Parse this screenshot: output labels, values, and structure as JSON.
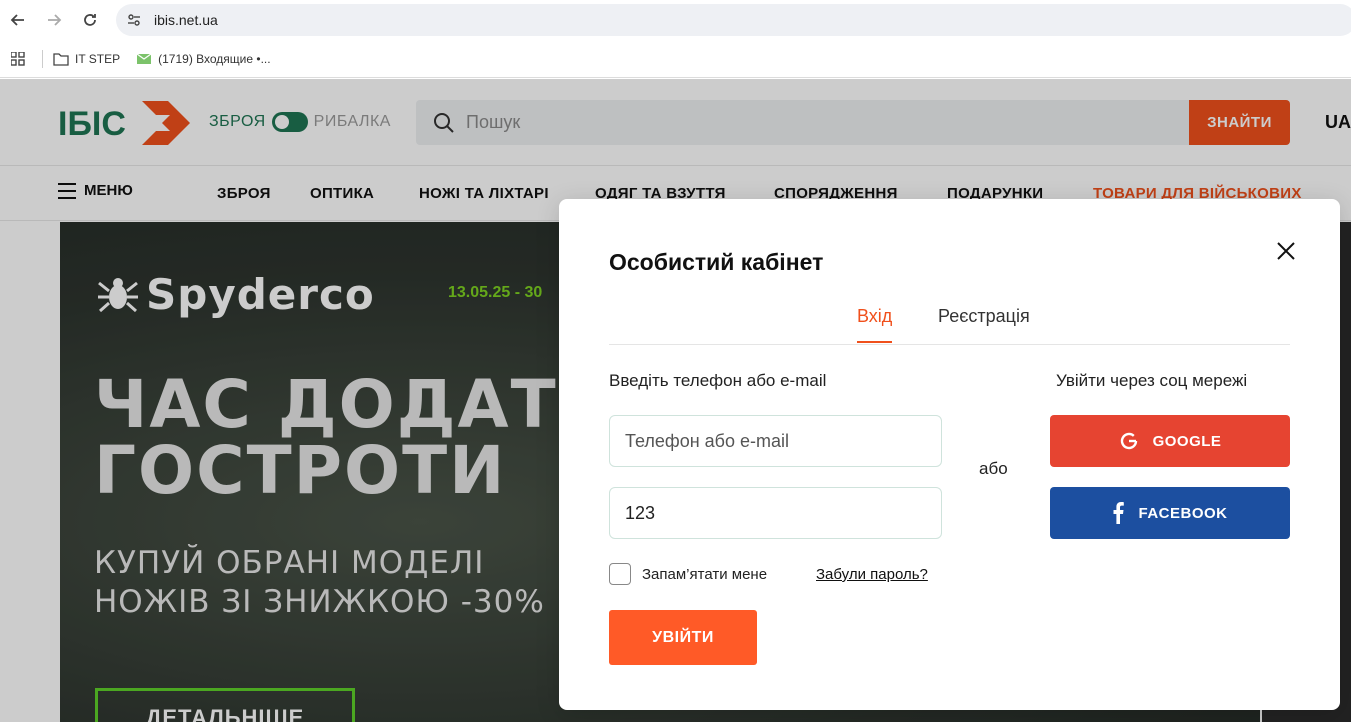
{
  "browser": {
    "url": "ibis.net.ua",
    "bookmarks": [
      {
        "label": "IT STEP"
      },
      {
        "label": "(1719) Входящие •..."
      }
    ]
  },
  "header": {
    "logo_text": "ІБІС",
    "mode_left": "ЗБРОЯ",
    "mode_right": "РИБАЛКА",
    "search_placeholder": "Пошук",
    "search_button": "ЗНАЙТИ",
    "lang": "UA"
  },
  "nav": {
    "menu_label": "МЕНЮ",
    "items": [
      {
        "label": "ЗБРОЯ"
      },
      {
        "label": "ОПТИКА"
      },
      {
        "label": "НОЖІ ТА ЛІХТАРІ"
      },
      {
        "label": "ОДЯГ ТА ВЗУТТЯ"
      },
      {
        "label": "СПОРЯДЖЕННЯ"
      },
      {
        "label": "ПОДАРУНКИ"
      },
      {
        "label": "ТОВАРИ ДЛЯ ВІЙСЬКОВИХ"
      }
    ]
  },
  "banner": {
    "brand": "Spyderco",
    "date": "13.05.25 - 30",
    "headline_1": "ЧАС ДОДАТ",
    "headline_2": "ГОСТРОТИ",
    "sub_1": "КУПУЙ ОБРАНІ МОДЕЛІ",
    "sub_2": "НОЖІВ ЗІ ЗНИЖКОЮ -30%",
    "button": "ДЕТАЛЬНІШЕ"
  },
  "modal": {
    "title": "Особистий кабінет",
    "tab_login": "Вхід",
    "tab_register": "Реєстрація",
    "form_label": "Введіть телефон або e-mail",
    "login_placeholder": "Телефон або e-mail",
    "password_value": "123",
    "remember_label": "Запам’ятати мене",
    "forgot_link": "Забули пароль?",
    "submit": "УВІЙТИ",
    "or": "або",
    "social_label": "Увійти через соц мережі",
    "google": "GOOGLE",
    "facebook": "FACEBOOK"
  },
  "colors": {
    "accent": "#f0501c",
    "brand_green": "#1e7553",
    "google": "#e64431",
    "facebook": "#1c4fa0"
  }
}
